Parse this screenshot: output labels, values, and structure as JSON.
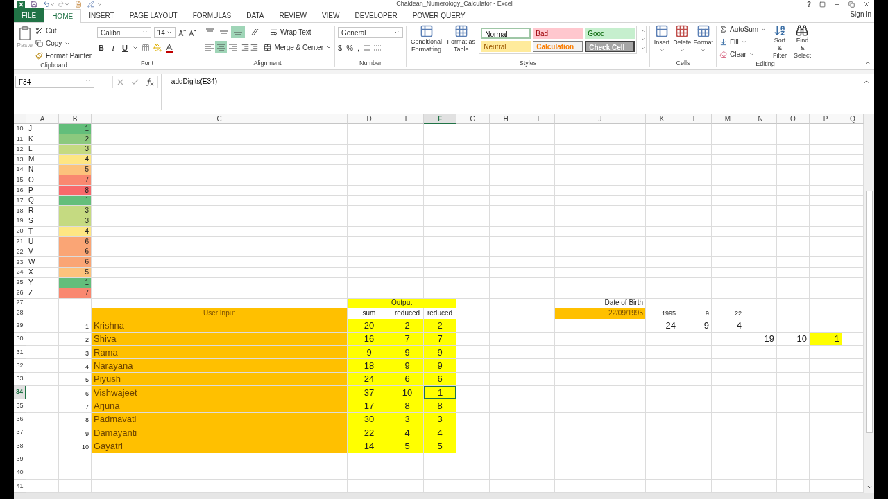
{
  "window": {
    "title": "Chaldean_Numerology_Calculator - Excel",
    "help": "?",
    "sign_in": "Sign in"
  },
  "ribbon_tabs": [
    {
      "label": "FILE",
      "kind": "file",
      "selected": false
    },
    {
      "label": "HOME",
      "kind": "tab",
      "selected": true
    },
    {
      "label": "INSERT",
      "kind": "tab",
      "selected": false
    },
    {
      "label": "PAGE LAYOUT",
      "kind": "tab",
      "selected": false
    },
    {
      "label": "FORMULAS",
      "kind": "tab",
      "selected": false
    },
    {
      "label": "DATA",
      "kind": "tab",
      "selected": false
    },
    {
      "label": "REVIEW",
      "kind": "tab",
      "selected": false
    },
    {
      "label": "VIEW",
      "kind": "tab",
      "selected": false
    },
    {
      "label": "DEVELOPER",
      "kind": "tab",
      "selected": false
    },
    {
      "label": "POWER QUERY",
      "kind": "tab",
      "selected": false
    }
  ],
  "clipboard": {
    "paste": "Paste",
    "cut": "Cut",
    "copy": "Copy",
    "format_painter": "Format Painter",
    "label": "Clipboard"
  },
  "font": {
    "name": "Calibri",
    "size": "14",
    "styles": [
      {
        "label": "B",
        "kind": "bold"
      },
      {
        "label": "I",
        "kind": "italic"
      },
      {
        "label": "U",
        "kind": "underline"
      }
    ],
    "label": "Font"
  },
  "alignment": {
    "vertical": [
      {
        "selected": false
      },
      {
        "selected": false
      },
      {
        "selected": true
      }
    ],
    "horizontal": [
      {
        "selected": false
      },
      {
        "selected": true
      },
      {
        "selected": false
      }
    ],
    "wrap_text": "Wrap Text",
    "merge": "Merge & Center",
    "label": "Alignment"
  },
  "number": {
    "format": "General",
    "symbols": [
      "$",
      "%",
      ","
    ],
    "label": "Number"
  },
  "styles": {
    "conditional": "Conditional Formatting",
    "format_table": "Format as Table",
    "cell_styles": [
      {
        "label": "Normal",
        "kind": "normal"
      },
      {
        "label": "Bad",
        "kind": "bad"
      },
      {
        "label": "Good",
        "kind": "good"
      },
      {
        "label": "Neutral",
        "kind": "neutral"
      },
      {
        "label": "Calculation",
        "kind": "calculation"
      },
      {
        "label": "Check Cell",
        "kind": "check"
      }
    ],
    "label": "Styles"
  },
  "cells": {
    "buttons": [
      {
        "label": "Insert",
        "kind": "insert"
      },
      {
        "label": "Delete",
        "kind": "delete"
      },
      {
        "label": "Format",
        "kind": "format"
      }
    ],
    "label": "Cells"
  },
  "editing": {
    "autosum": "AutoSum",
    "fill": "Fill",
    "clear": "Clear",
    "sort": "Sort & Filter",
    "find": "Find & Select",
    "label": "Editing"
  },
  "formula_bar": {
    "name_box": "F34",
    "formula": "=addDigits(E34)"
  },
  "sheet": {
    "columns": [
      {
        "label": "A",
        "selected": false
      },
      {
        "label": "B",
        "selected": false
      },
      {
        "label": "C",
        "selected": false
      },
      {
        "label": "D",
        "selected": false
      },
      {
        "label": "E",
        "selected": false
      },
      {
        "label": "F",
        "selected": true
      },
      {
        "label": "G",
        "selected": false
      },
      {
        "label": "H",
        "selected": false
      },
      {
        "label": "I",
        "selected": false
      },
      {
        "label": "J",
        "selected": false
      },
      {
        "label": "K",
        "selected": false
      },
      {
        "label": "L",
        "selected": false
      },
      {
        "label": "M",
        "selected": false
      },
      {
        "label": "N",
        "selected": false
      },
      {
        "label": "O",
        "selected": false
      },
      {
        "label": "P",
        "selected": false
      },
      {
        "label": "Q",
        "selected": false
      }
    ],
    "row_headers": [
      {
        "label": "10",
        "selected": false
      },
      {
        "label": "11",
        "selected": false
      },
      {
        "label": "12",
        "selected": false
      },
      {
        "label": "13",
        "selected": false
      },
      {
        "label": "14",
        "selected": false
      },
      {
        "label": "15",
        "selected": false
      },
      {
        "label": "16",
        "selected": false
      },
      {
        "label": "17",
        "selected": false
      },
      {
        "label": "18",
        "selected": false
      },
      {
        "label": "19",
        "selected": false
      },
      {
        "label": "20",
        "selected": false
      },
      {
        "label": "21",
        "selected": false
      },
      {
        "label": "22",
        "selected": false
      },
      {
        "label": "23",
        "selected": false
      },
      {
        "label": "24",
        "selected": false
      },
      {
        "label": "25",
        "selected": false
      },
      {
        "label": "26",
        "selected": false
      },
      {
        "label": "27",
        "selected": false
      },
      {
        "label": "28",
        "selected": false
      },
      {
        "label": "29",
        "selected": false
      },
      {
        "label": "30",
        "selected": false
      },
      {
        "label": "31",
        "selected": false
      },
      {
        "label": "32",
        "selected": false
      },
      {
        "label": "33",
        "selected": false
      },
      {
        "label": "34",
        "selected": true
      },
      {
        "label": "35",
        "selected": false
      },
      {
        "label": "36",
        "selected": false
      },
      {
        "label": "37",
        "selected": false
      },
      {
        "label": "38",
        "selected": false
      },
      {
        "label": "39",
        "selected": false
      },
      {
        "label": "40",
        "selected": false
      },
      {
        "label": "41",
        "selected": false
      }
    ],
    "letter_values": [
      {
        "letter": "J",
        "value": "1",
        "color": "#63be7b"
      },
      {
        "letter": "K",
        "value": "2",
        "color": "#8cc97e"
      },
      {
        "letter": "L",
        "value": "3",
        "color": "#c5da81"
      },
      {
        "letter": "M",
        "value": "4",
        "color": "#fee683"
      },
      {
        "letter": "N",
        "value": "5",
        "color": "#fcc27c"
      },
      {
        "letter": "O",
        "value": "7",
        "color": "#f98870"
      },
      {
        "letter": "P",
        "value": "8",
        "color": "#f8696b"
      },
      {
        "letter": "Q",
        "value": "1",
        "color": "#63be7b"
      },
      {
        "letter": "R",
        "value": "3",
        "color": "#c5da81"
      },
      {
        "letter": "S",
        "value": "3",
        "color": "#c5da81"
      },
      {
        "letter": "T",
        "value": "4",
        "color": "#fee683"
      },
      {
        "letter": "U",
        "value": "6",
        "color": "#faa575"
      },
      {
        "letter": "V",
        "value": "6",
        "color": "#faa575"
      },
      {
        "letter": "W",
        "value": "6",
        "color": "#faa575"
      },
      {
        "letter": "X",
        "value": "5",
        "color": "#fcc27c"
      },
      {
        "letter": "Y",
        "value": "1",
        "color": "#63be7b"
      },
      {
        "letter": "Z",
        "value": "7",
        "color": "#f98870"
      }
    ],
    "user_input": {
      "title": "User Input",
      "names": [
        {
          "index": "1",
          "name": "Krishna"
        },
        {
          "index": "2",
          "name": "Shiva"
        },
        {
          "index": "3",
          "name": "Rama"
        },
        {
          "index": "4",
          "name": "Narayana"
        },
        {
          "index": "5",
          "name": "Piyush"
        },
        {
          "index": "6",
          "name": "Vishwajeet"
        },
        {
          "index": "7",
          "name": "Arjuna"
        },
        {
          "index": "8",
          "name": "Padmavati"
        },
        {
          "index": "9",
          "name": "Damayanti"
        },
        {
          "index": "10",
          "name": "Gayatri"
        }
      ]
    },
    "output": {
      "title": "Output",
      "columns": [
        "sum",
        "reduced",
        "reduced"
      ],
      "rows": [
        {
          "cells": [
            {
              "text": "20",
              "selected": false
            },
            {
              "text": "2",
              "selected": false
            },
            {
              "text": "2",
              "selected": false
            }
          ]
        },
        {
          "cells": [
            {
              "text": "16",
              "selected": false
            },
            {
              "text": "7",
              "selected": false
            },
            {
              "text": "7",
              "selected": false
            }
          ]
        },
        {
          "cells": [
            {
              "text": "9",
              "selected": false
            },
            {
              "text": "9",
              "selected": false
            },
            {
              "text": "9",
              "selected": false
            }
          ]
        },
        {
          "cells": [
            {
              "text": "18",
              "selected": false
            },
            {
              "text": "9",
              "selected": false
            },
            {
              "text": "9",
              "selected": false
            }
          ]
        },
        {
          "cells": [
            {
              "text": "24",
              "selected": false
            },
            {
              "text": "6",
              "selected": false
            },
            {
              "text": "6",
              "selected": false
            }
          ]
        },
        {
          "cells": [
            {
              "text": "37",
              "selected": false
            },
            {
              "text": "10",
              "selected": false
            },
            {
              "text": "1",
              "selected": true
            }
          ]
        },
        {
          "cells": [
            {
              "text": "17",
              "selected": false
            },
            {
              "text": "8",
              "selected": false
            },
            {
              "text": "8",
              "selected": false
            }
          ]
        },
        {
          "cells": [
            {
              "text": "30",
              "selected": false
            },
            {
              "text": "3",
              "selected": false
            },
            {
              "text": "3",
              "selected": false
            }
          ]
        },
        {
          "cells": [
            {
              "text": "22",
              "selected": false
            },
            {
              "text": "4",
              "selected": false
            },
            {
              "text": "4",
              "selected": false
            }
          ]
        },
        {
          "cells": [
            {
              "text": "14",
              "selected": false
            },
            {
              "text": "5",
              "selected": false
            },
            {
              "text": "5",
              "selected": false
            }
          ]
        }
      ]
    },
    "date_of_birth": {
      "label": "Date of Birth",
      "value": "22/09/1995",
      "parts": [
        "1995",
        "9",
        "22"
      ],
      "sums": [
        "24",
        "9",
        "4"
      ],
      "reduction": [
        {
          "text": "19",
          "highlighted": false
        },
        {
          "text": "10",
          "highlighted": false
        },
        {
          "text": "1",
          "highlighted": true
        }
      ]
    }
  }
}
